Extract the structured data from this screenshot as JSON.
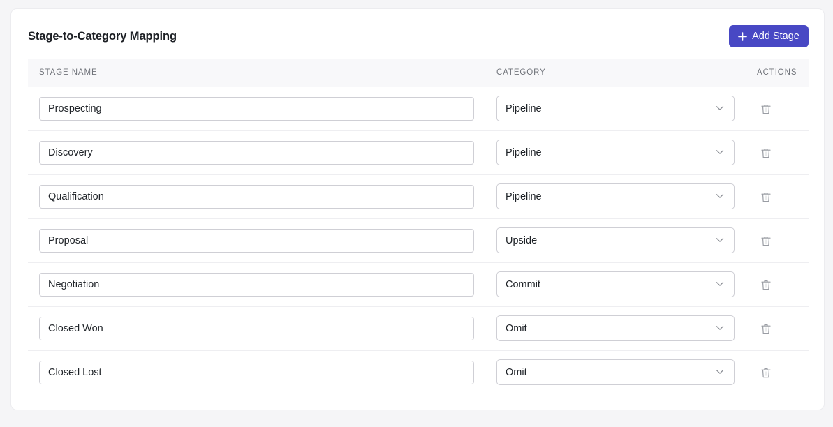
{
  "header": {
    "title": "Stage-to-Category Mapping",
    "add_button_label": "Add Stage"
  },
  "table": {
    "columns": [
      "Stage Name",
      "Category",
      "Actions"
    ],
    "rows": [
      {
        "stage": "Prospecting",
        "category": "Pipeline"
      },
      {
        "stage": "Discovery",
        "category": "Pipeline"
      },
      {
        "stage": "Qualification",
        "category": "Pipeline"
      },
      {
        "stage": "Proposal",
        "category": "Upside"
      },
      {
        "stage": "Negotiation",
        "category": "Commit"
      },
      {
        "stage": "Closed Won",
        "category": "Omit"
      },
      {
        "stage": "Closed Lost",
        "category": "Omit"
      }
    ]
  },
  "icons": {
    "add": "plus-icon",
    "dropdown": "chevron-down-icon",
    "delete": "trash-icon"
  },
  "colors": {
    "accent": "#4848c4",
    "icon_muted": "#9a9da4"
  }
}
